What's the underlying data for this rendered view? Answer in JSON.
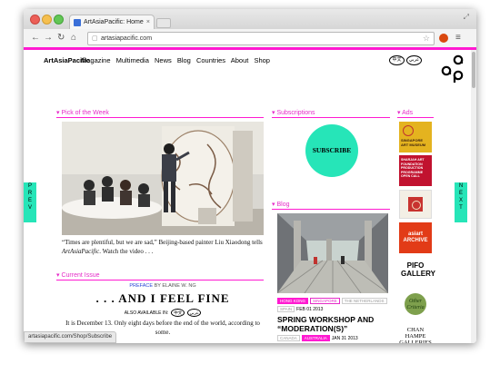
{
  "browser": {
    "tab_title": "ArtAsiaPacific: Home",
    "tab_close": "×",
    "url": "artasiapacific.com",
    "status_url": "artasiapacific.com/Shop/Subscribe",
    "back": "←",
    "forward": "→",
    "reload": "C",
    "home": "⌂",
    "star": "☆",
    "menu": "≡"
  },
  "site": {
    "brand": "ArtAsiaPacific",
    "nav": [
      "Magazine",
      "Multimedia",
      "News",
      "Blog",
      "Countries",
      "About",
      "Shop"
    ],
    "lang_buttons": [
      "中文",
      "عربي"
    ]
  },
  "pick": {
    "heading": "Pick of the Week",
    "caption_plain": "“Times are plentiful, but we are sad,” Beijing-based painter Liu Xiaodong tells ",
    "caption_em": "ArtAsiaPacific",
    "caption_end": ". Watch the video . . ."
  },
  "issue": {
    "heading": "Current Issue",
    "preface": "PREFACE",
    "by": "BY ELAINE W. NG",
    "headline": ". . . AND I FEEL FINE",
    "also": "ALSO AVAILABLE IN:",
    "also_langs": [
      "中文",
      "عربي"
    ],
    "text": "It is December 13. Only eight days before the end of the world, according to some."
  },
  "subscriptions": {
    "heading": "Subscriptions",
    "button": "SUBSCRIBE"
  },
  "blog": {
    "heading": "Blog",
    "tags": [
      "HONG KONG",
      "SINGAPORE",
      "THE NETHERLANDS",
      "SPAIN"
    ],
    "date": "FEB 01 2013",
    "title": "SPRING WORKSHOP AND “MODERATION(S)”",
    "tags2": [
      "CANADA",
      "AUSTRALIA"
    ],
    "date2": "JAN 31 2013"
  },
  "ads": {
    "heading": "Ads",
    "items": [
      {
        "label": "SINGAPORE ART MUSEUM",
        "bg": "#e4b31f"
      },
      {
        "label": "SHARJAH ART FOUNDATION PRODUCTION PROGRAMME OPEN CALL",
        "bg": "#c1122f"
      },
      {
        "label": "",
        "bg": "#f3efe5"
      },
      {
        "label": "asiart ARCHIVE",
        "bg": "#e23b17"
      },
      {
        "label": "PIFO GALLERY",
        "bg": "#ffffff"
      },
      {
        "label": "Other Criteria",
        "bg": "#ffffff"
      },
      {
        "label": "CHAN HAMPE GALLERIES",
        "bg": "#ffffff"
      }
    ]
  },
  "pager": {
    "prev": "PREV",
    "next": "NEXT"
  },
  "colors": {
    "accent": "#ff1ad1",
    "teal": "#26e5b8"
  }
}
